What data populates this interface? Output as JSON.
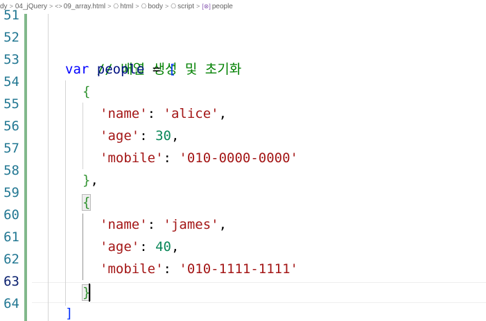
{
  "breadcrumb": {
    "items": [
      {
        "label": "dy",
        "icon": "none"
      },
      {
        "label": "04_jQuery",
        "icon": "none"
      },
      {
        "label": "09_array.html",
        "icon": "html-file-icon"
      },
      {
        "label": "html",
        "icon": "element-icon"
      },
      {
        "label": "body",
        "icon": "element-icon"
      },
      {
        "label": "script",
        "icon": "element-icon"
      },
      {
        "label": "people",
        "icon": "variable-icon"
      }
    ],
    "separator": ">",
    "glyphs": {
      "html_file": "<>",
      "element": "⎔",
      "variable": "[⊗]"
    }
  },
  "editor": {
    "line_numbers": [
      "51",
      "52",
      "53",
      "54",
      "55",
      "56",
      "57",
      "58",
      "59",
      "60",
      "61",
      "62",
      "63",
      "64"
    ],
    "current_line": "63",
    "code": {
      "l52": {
        "comment": "// 배열 생성 및 초기화"
      },
      "l53": {
        "keyword": "var",
        "ident": "people",
        "op": " = ",
        "bracket": "["
      },
      "l54": {
        "bracket": "{"
      },
      "l55": {
        "key": "'name'",
        "colon": ": ",
        "value": "'alice'",
        "comma": ","
      },
      "l56": {
        "key": "'age'",
        "colon": ": ",
        "value": "30",
        "comma": ","
      },
      "l57": {
        "key": "'mobile'",
        "colon": ": ",
        "value": "'010-0000-0000'"
      },
      "l58": {
        "bracket": "}",
        "comma": ","
      },
      "l59": {
        "bracket": "{"
      },
      "l60": {
        "key": "'name'",
        "colon": ": ",
        "value": "'james'",
        "comma": ","
      },
      "l61": {
        "key": "'age'",
        "colon": ": ",
        "value": "40",
        "comma": ","
      },
      "l62": {
        "key": "'mobile'",
        "colon": ": ",
        "value": "'010-1111-1111'"
      },
      "l63": {
        "bracket": "}"
      },
      "l64": {
        "bracket": "]"
      }
    }
  },
  "colors": {
    "comment": "#008000",
    "keyword": "#0000ff",
    "identifier": "#001080",
    "string": "#a31515",
    "number": "#098658",
    "bracket_level1": "#0431fa",
    "bracket_level2": "#319331",
    "line_number": "#237893",
    "diff_added": "#81b88b"
  }
}
